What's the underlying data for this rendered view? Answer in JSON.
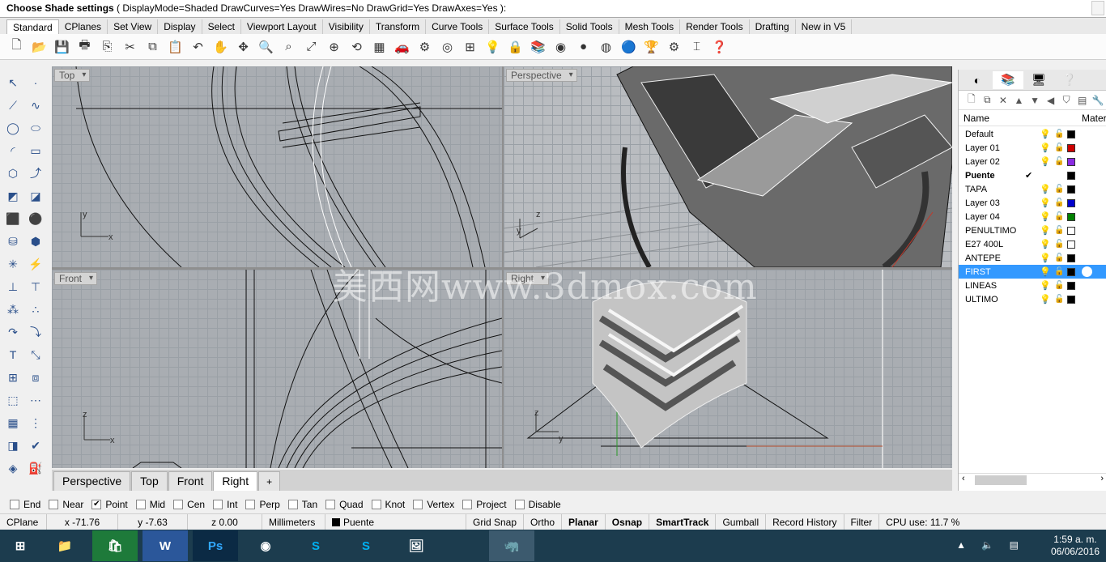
{
  "command": {
    "prompt": "Choose Shade settings",
    "options": "( DisplayMode=Shaded  DrawCurves=Yes  DrawWires=No  DrawGrid=Yes  DrawAxes=Yes ):"
  },
  "tabs": [
    "Standard",
    "CPlanes",
    "Set View",
    "Display",
    "Select",
    "Viewport Layout",
    "Visibility",
    "Transform",
    "Curve Tools",
    "Surface Tools",
    "Solid Tools",
    "Mesh Tools",
    "Render Tools",
    "Drafting",
    "New in V5"
  ],
  "active_tab": "Standard",
  "viewports": {
    "top": "Top",
    "perspective": "Perspective",
    "front": "Front",
    "right": "Right"
  },
  "axes": {
    "x": "x",
    "y": "y",
    "z": "z"
  },
  "viewport_tabs": [
    "Perspective",
    "Top",
    "Front",
    "Right"
  ],
  "viewport_tab_add": "+",
  "watermark": "美西网www.3dmox.com",
  "layers_panel": {
    "header_name": "Name",
    "header_material": "Mater",
    "layers": [
      {
        "name": "Default",
        "color": "#000000"
      },
      {
        "name": "Layer 01",
        "color": "#cc0000"
      },
      {
        "name": "Layer 02",
        "color": "#8a2be2"
      },
      {
        "name": "Puente",
        "color": "#000000",
        "current": true,
        "check": "✔"
      },
      {
        "name": "TAPA",
        "color": "#000000"
      },
      {
        "name": "Layer 03",
        "color": "#0000cc"
      },
      {
        "name": "Layer 04",
        "color": "#008000"
      },
      {
        "name": "PENULTIMO",
        "color": "#ffffff"
      },
      {
        "name": "E27 400L",
        "color": "#ffffff"
      },
      {
        "name": "ANTEPE",
        "color": "#000000"
      },
      {
        "name": "FIRST",
        "color": "#000000",
        "selected": true
      },
      {
        "name": "LINEAS",
        "color": "#000000"
      },
      {
        "name": "ULTIMO",
        "color": "#000000"
      }
    ]
  },
  "osnaps": [
    {
      "label": "End",
      "checked": false
    },
    {
      "label": "Near",
      "checked": false
    },
    {
      "label": "Point",
      "checked": true
    },
    {
      "label": "Mid",
      "checked": false
    },
    {
      "label": "Cen",
      "checked": false
    },
    {
      "label": "Int",
      "checked": false
    },
    {
      "label": "Perp",
      "checked": false
    },
    {
      "label": "Tan",
      "checked": false
    },
    {
      "label": "Quad",
      "checked": false
    },
    {
      "label": "Knot",
      "checked": false
    },
    {
      "label": "Vertex",
      "checked": false
    },
    {
      "label": "Project",
      "checked": false
    },
    {
      "label": "Disable",
      "checked": false
    }
  ],
  "status": {
    "cplane": "CPlane",
    "x": "x -71.76",
    "y": "y -7.63",
    "z": "z 0.00",
    "units": "Millimeters",
    "layer": "Puente",
    "grid_snap": "Grid Snap",
    "ortho": "Ortho",
    "planar": "Planar",
    "osnap": "Osnap",
    "smarttrack": "SmartTrack",
    "gumball": "Gumball",
    "record_history": "Record History",
    "filter": "Filter",
    "cpu": "CPU use: 11.7 %"
  },
  "taskbar": {
    "time": "1:59 a. m.",
    "date": "06/06/2016"
  }
}
